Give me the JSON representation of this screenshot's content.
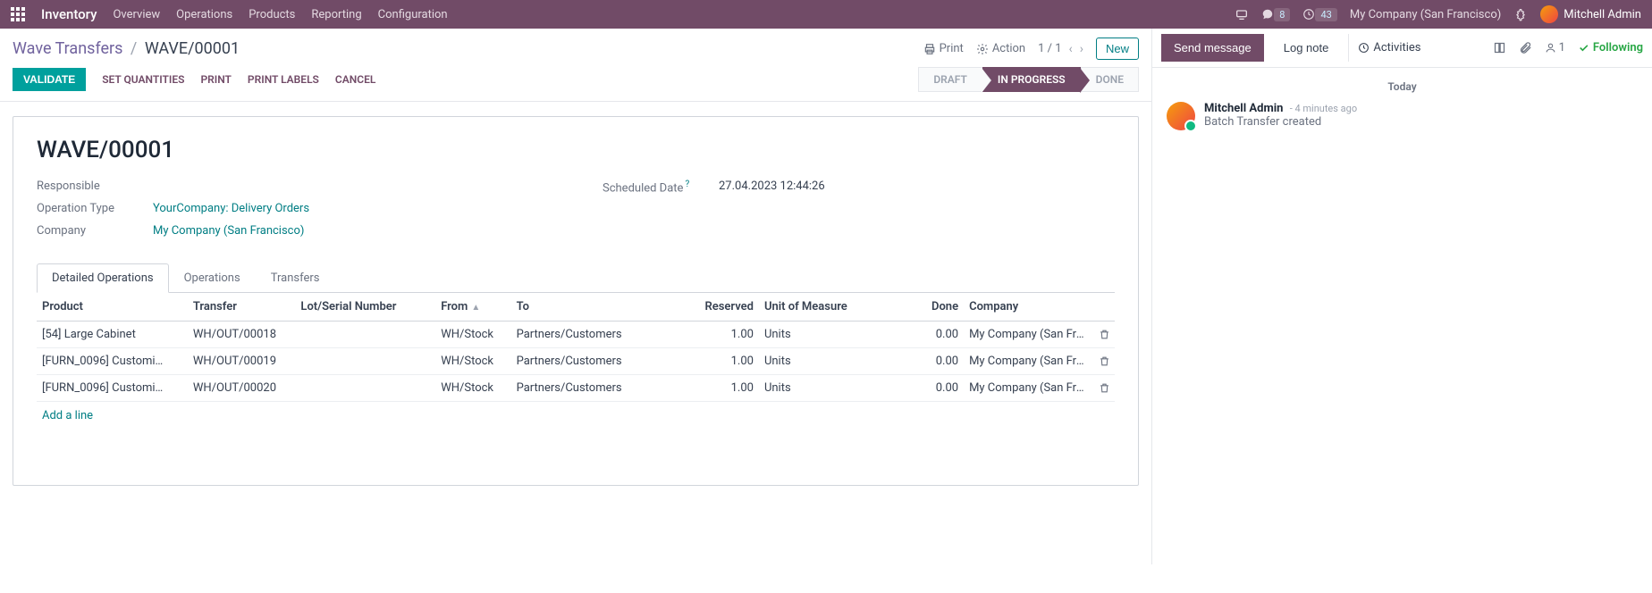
{
  "navbar": {
    "app": "Inventory",
    "menus": [
      "Overview",
      "Operations",
      "Products",
      "Reporting",
      "Configuration"
    ],
    "chat_badge": "8",
    "clock_badge": "43",
    "company": "My Company (San Francisco)",
    "user": "Mitchell Admin"
  },
  "breadcrumb": {
    "parent": "Wave Transfers",
    "current": "WAVE/00001",
    "print": "Print",
    "action": "Action",
    "pager": "1 / 1",
    "new": "New"
  },
  "buttons": {
    "validate": "VALIDATE",
    "set_quantities": "SET QUANTITIES",
    "print": "PRINT",
    "print_labels": "PRINT LABELS",
    "cancel": "CANCEL"
  },
  "status": {
    "draft": "DRAFT",
    "in_progress": "IN PROGRESS",
    "done": "DONE"
  },
  "form": {
    "title": "WAVE/00001",
    "labels": {
      "responsible": "Responsible",
      "operation_type": "Operation Type",
      "company": "Company",
      "scheduled_date": "Scheduled Date"
    },
    "values": {
      "responsible": "",
      "operation_type": "YourCompany: Delivery Orders",
      "company": "My Company (San Francisco)",
      "scheduled_date": "27.04.2023 12:44:26"
    }
  },
  "tabs": {
    "detailed": "Detailed Operations",
    "operations": "Operations",
    "transfers": "Transfers"
  },
  "table": {
    "headers": {
      "product": "Product",
      "transfer": "Transfer",
      "lot": "Lot/Serial Number",
      "from": "From",
      "to": "To",
      "reserved": "Reserved",
      "uom": "Unit of Measure",
      "done": "Done",
      "company": "Company"
    },
    "rows": [
      {
        "product": "[54] Large Cabinet",
        "transfer": "WH/OUT/00018",
        "lot": "",
        "from": "WH/Stock",
        "to": "Partners/Customers",
        "reserved": "1.00",
        "uom": "Units",
        "done": "0.00",
        "company": "My Company (San Fran…"
      },
      {
        "product": "[FURN_0096] Customi…",
        "transfer": "WH/OUT/00019",
        "lot": "",
        "from": "WH/Stock",
        "to": "Partners/Customers",
        "reserved": "1.00",
        "uom": "Units",
        "done": "0.00",
        "company": "My Company (San Fran…"
      },
      {
        "product": "[FURN_0096] Customi…",
        "transfer": "WH/OUT/00020",
        "lot": "",
        "from": "WH/Stock",
        "to": "Partners/Customers",
        "reserved": "1.00",
        "uom": "Units",
        "done": "0.00",
        "company": "My Company (San Fran…"
      }
    ],
    "add_line": "Add a line"
  },
  "chatter": {
    "send": "Send message",
    "log": "Log note",
    "activities": "Activities",
    "follower_count": "1",
    "following": "Following",
    "date_header": "Today",
    "message": {
      "author": "Mitchell Admin",
      "time": "- 4 minutes ago",
      "body": "Batch Transfer created"
    }
  }
}
